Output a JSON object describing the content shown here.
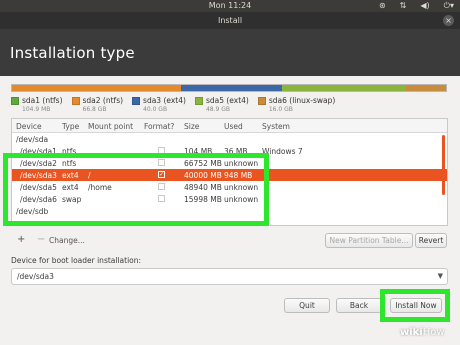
{
  "topbar": {
    "clock": "Mon 11:24",
    "icons": [
      "accessibility-icon",
      "network-icon",
      "volume-icon",
      "power-icon"
    ]
  },
  "window": {
    "title": "Install",
    "close_glyph": "×"
  },
  "header": {
    "title": "Installation type"
  },
  "partitions": [
    {
      "name": "sda1 (ntfs)",
      "size": "104.9 MB",
      "color": "#5eaa3c"
    },
    {
      "name": "sda2 (ntfs)",
      "size": "66.8 GB",
      "color": "#e48a2c"
    },
    {
      "name": "sda3 (ext4)",
      "size": "40.0 GB",
      "color": "#3c68a8"
    },
    {
      "name": "sda5 (ext4)",
      "size": "48.9 GB",
      "color": "#8ab43c"
    },
    {
      "name": "sda6 (linux-swap)",
      "size": "16.0 GB",
      "color": "#c88c3c"
    }
  ],
  "partition_bar_fractions": [
    0.001,
    0.389,
    0.233,
    0.284,
    0.093
  ],
  "table": {
    "headers": {
      "device": "Device",
      "type": "Type",
      "mount": "Mount point",
      "format": "Format?",
      "size": "Size",
      "used": "Used",
      "system": "System"
    },
    "rows": [
      {
        "device": "/dev/sda",
        "type": "",
        "mount": "",
        "size": "",
        "used": "",
        "system": ""
      },
      {
        "device": "/dev/sda1",
        "type": "ntfs",
        "mount": "",
        "size": "104 MB",
        "used": "36 MB",
        "system": "Windows 7"
      },
      {
        "device": "/dev/sda2",
        "type": "ntfs",
        "mount": "",
        "size": "66752 MB",
        "used": "unknown",
        "system": ""
      },
      {
        "device": "/dev/sda3",
        "type": "ext4",
        "mount": "/",
        "size": "40000 MB",
        "used": "948 MB",
        "system": ""
      },
      {
        "device": "/dev/sda5",
        "type": "ext4",
        "mount": "/home",
        "size": "48940 MB",
        "used": "unknown",
        "system": ""
      },
      {
        "device": "/dev/sda6",
        "type": "swap",
        "mount": "",
        "size": "15998 MB",
        "used": "unknown",
        "system": ""
      },
      {
        "device": "/dev/sdb",
        "type": "",
        "mount": "",
        "size": "",
        "used": "",
        "system": ""
      }
    ],
    "selected_row": 3,
    "checked_row": 3
  },
  "toolbar": {
    "add": "+",
    "remove": "−",
    "change": "Change...",
    "new_table": "New Partition Table...",
    "revert": "Revert"
  },
  "bootloader": {
    "label": "Device for boot loader installation:",
    "value": "/dev/sda3"
  },
  "buttons": {
    "quit": "Quit",
    "back": "Back",
    "install": "Install Now"
  },
  "watermark": {
    "wiki": "wiki",
    "how": "How"
  },
  "accent": "#e95420",
  "highlight": "#2ee62e"
}
